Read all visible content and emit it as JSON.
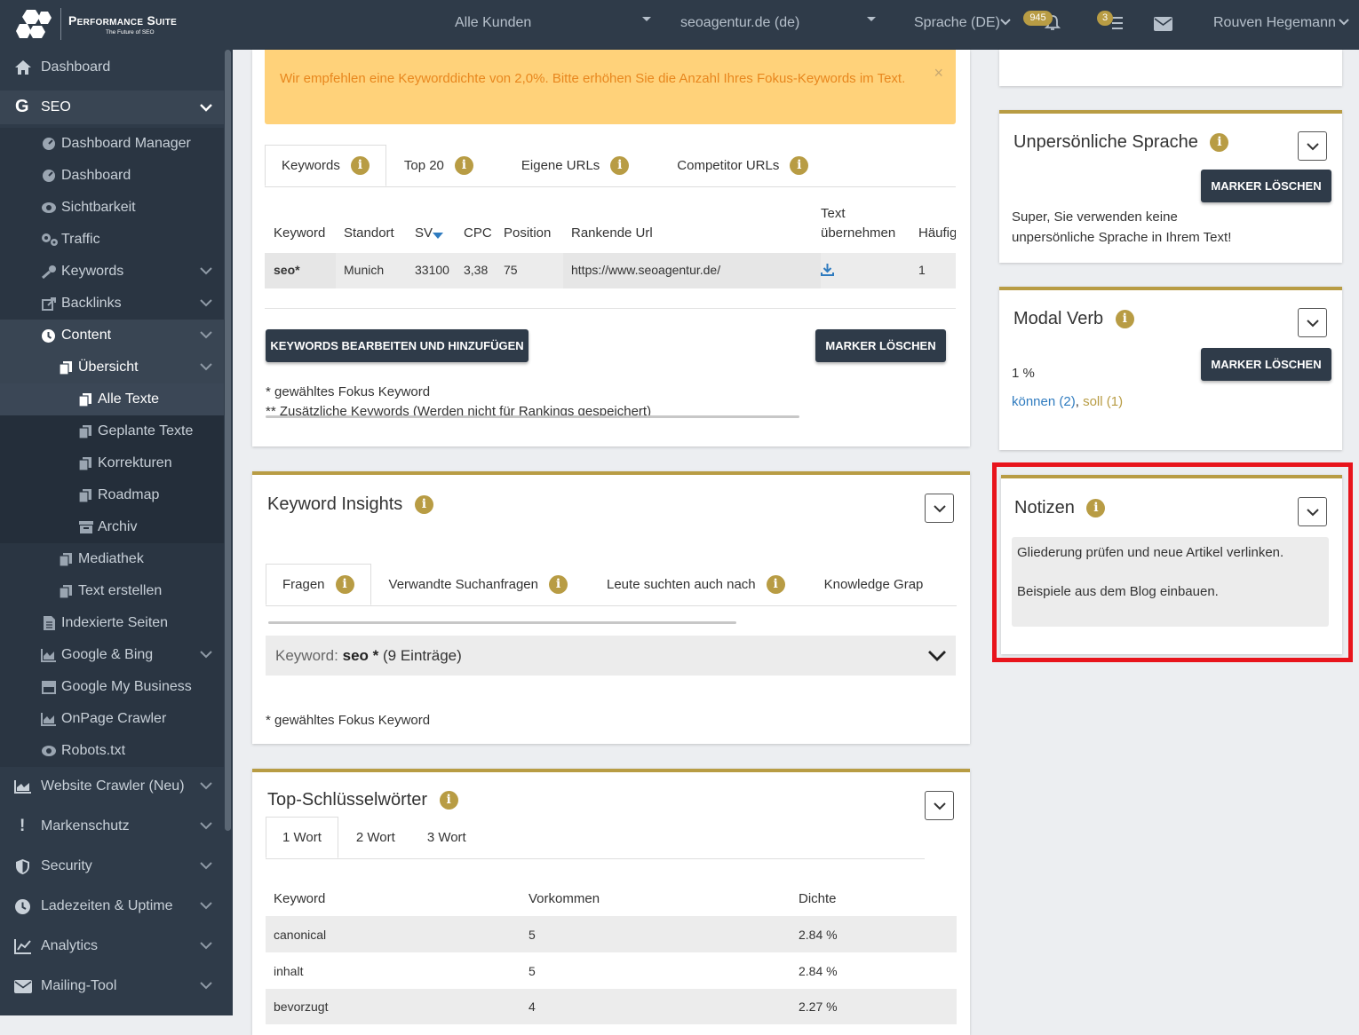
{
  "topbar": {
    "brand": "Performance Suite",
    "tagline": "The Future of SEO",
    "customer_select": "Alle Kunden",
    "project_select": "seoagentur.de (de)",
    "language": "Sprache (DE)",
    "notifications_count": "945",
    "tasks_count": "3",
    "user": "Rouven Hegemann"
  },
  "sidebar": {
    "dashboard": "Dashboard",
    "seo": "SEO",
    "dashboard_manager": "Dashboard Manager",
    "dashboard2": "Dashboard",
    "sichtbarkeit": "Sichtbarkeit",
    "traffic": "Traffic",
    "keywords": "Keywords",
    "backlinks": "Backlinks",
    "content": "Content",
    "uebersicht": "Übersicht",
    "alle_texte": "Alle Texte",
    "geplante_texte": "Geplante Texte",
    "korrekturen": "Korrekturen",
    "roadmap": "Roadmap",
    "archiv": "Archiv",
    "mediathek": "Mediathek",
    "text_erstellen": "Text erstellen",
    "indexierte_seiten": "Indexierte Seiten",
    "google_bing": "Google & Bing",
    "google_my_business": "Google My Business",
    "onpage_crawler": "OnPage Crawler",
    "robots": "Robots.txt",
    "website_crawler": "Website Crawler (Neu)",
    "markenschutz": "Markenschutz",
    "security": "Security",
    "ladezeiten": "Ladezeiten & Uptime",
    "analytics": "Analytics",
    "mailing": "Mailing-Tool"
  },
  "keyword_panel": {
    "alert": "Wir empfehlen eine Keyworddichte von 2,0%. Bitte erhöhen Sie die Anzahl Ihres Fokus-Keywords im Text.",
    "alert_close": "×",
    "tabs": [
      "Keywords",
      "Top 20",
      "Eigene URLs",
      "Competitor URLs"
    ],
    "columns": {
      "keyword": "Keyword",
      "standort": "Standort",
      "sv": "SV",
      "cpc": "CPC",
      "position": "Position",
      "url": "Rankende Url",
      "text1": "Text",
      "text2": "übernehmen",
      "haeufig": "Häufig"
    },
    "row": {
      "keyword": "seo*",
      "standort": "Munich",
      "sv": "33100",
      "cpc": "3,38",
      "position": "75",
      "url": "https://www.seoagentur.de/",
      "haeufig": "1"
    },
    "edit_button": "KEYWORDS BEARBEITEN UND HINZUFÜGEN",
    "clear_button": "MARKER LÖSCHEN",
    "note1": "* gewähltes Fokus Keyword",
    "note2": "** Zusätzliche Keywords (Werden nicht für Rankings gespeichert)"
  },
  "insights_panel": {
    "title": "Keyword Insights",
    "tabs": [
      "Fragen",
      "Verwandte Suchanfragen",
      "Leute suchten auch nach",
      "Knowledge Grap"
    ],
    "accordion_prefix": "Keyword:",
    "accordion_keyword": "seo *",
    "accordion_count": "(9 Einträge)",
    "note": "* gewähltes Fokus Keyword"
  },
  "top_panel": {
    "title": "Top-Schlüsselwörter",
    "tabs": [
      "1 Wort",
      "2 Wort",
      "3 Wort"
    ],
    "columns": [
      "Keyword",
      "Vorkommen",
      "Dichte"
    ],
    "rows": [
      {
        "keyword": "canonical",
        "count": "5",
        "density": "2.84 %"
      },
      {
        "keyword": "inhalt",
        "count": "5",
        "density": "2.84 %"
      },
      {
        "keyword": "bevorzugt",
        "count": "4",
        "density": "2.27 %"
      }
    ]
  },
  "unpersoenlich_panel": {
    "title": "Unpersönliche Sprache",
    "button": "MARKER LÖSCHEN",
    "text1": "Super, Sie verwenden keine",
    "text2": "unpersönliche Sprache in Ihrem Text!"
  },
  "modal_panel": {
    "title": "Modal Verb",
    "button": "MARKER LÖSCHEN",
    "percent": "1 %",
    "verb1": "können (2)",
    "separator": ",",
    "verb2": "soll (1)"
  },
  "notes_panel": {
    "title": "Notizen",
    "line1": "Gliederung prüfen und neue Artikel verlinken.",
    "line2": "Beispiele aus dem Blog einbauen."
  },
  "colors": {
    "accent": "#b89c44",
    "sidebar": "#2f3b49",
    "highlight": "#e8141c",
    "alert_bg": "#ffd27a",
    "alert_text": "#e8871e",
    "link_blue": "#2f7bbf"
  }
}
